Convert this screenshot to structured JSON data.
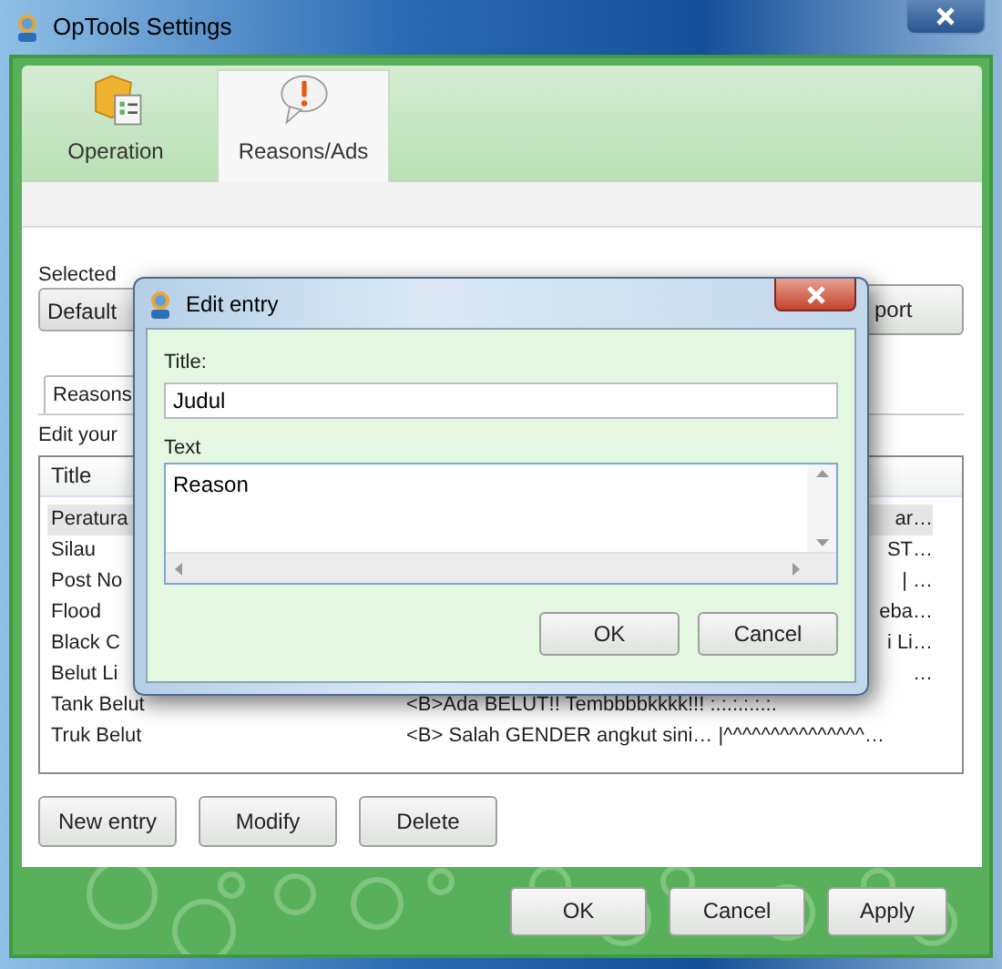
{
  "window": {
    "title": "OpTools Settings"
  },
  "tabs": [
    {
      "label": "Operation",
      "selected": false
    },
    {
      "label": "Reasons/Ads",
      "selected": true
    }
  ],
  "pack": {
    "label": "Selected",
    "value": "Default",
    "side_button": "port"
  },
  "subtabs": [
    {
      "label": "Reasons",
      "selected": true
    }
  ],
  "list_label": "Edit your",
  "table": {
    "columns": [
      "Title"
    ],
    "rows": [
      {
        "title": "Peratura",
        "text": "ar…",
        "selected": true
      },
      {
        "title": "Silau",
        "text": "ST…",
        "selected": false
      },
      {
        "title": "Post No",
        "text": "| …",
        "selected": false
      },
      {
        "title": "Flood",
        "text": "eba…",
        "selected": false
      },
      {
        "title": "Black C",
        "text": "i Li…",
        "selected": false
      },
      {
        "title": "Belut Li",
        "text": "…",
        "selected": false
      },
      {
        "title": "Tank Belut",
        "text": "<B>Ada BELUT!! Tembbbbkkkk!!! :.:.:.:.:.:.",
        "selected": false
      },
      {
        "title": "Truk Belut",
        "text": "<B> Salah GENDER angkut sini… |^^^^^^^^^^^^^^^…",
        "selected": false
      }
    ]
  },
  "list_buttons": [
    "New entry",
    "Modify",
    "Delete"
  ],
  "footer_buttons": [
    "OK",
    "Cancel",
    "Apply"
  ],
  "dialog": {
    "title": "Edit entry",
    "title_label": "Title:",
    "title_value": "Judul",
    "text_label": "Text",
    "text_value": "Reason",
    "buttons": [
      "OK",
      "Cancel"
    ]
  }
}
